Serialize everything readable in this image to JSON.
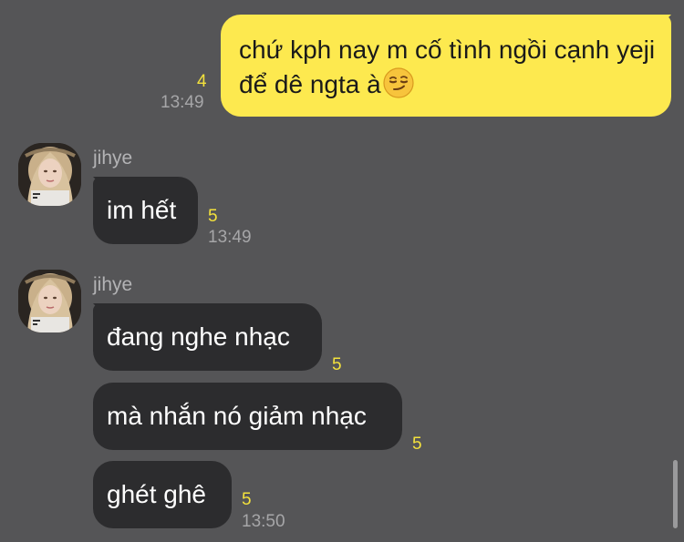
{
  "outgoing": {
    "text": "chứ kph nay m cố tình ngồi cạnh yeji để dê ngta à",
    "emoji": "smirking-face",
    "unread": "4",
    "time": "13:49"
  },
  "groups": [
    {
      "sender": "jihye",
      "messages": [
        {
          "text": "im hết",
          "unread": "5",
          "time": "13:49"
        }
      ]
    },
    {
      "sender": "jihye",
      "messages": [
        {
          "text": "đang nghe nhạc",
          "unread": "5"
        },
        {
          "text": "mà nhắn nó giảm nhạc",
          "unread": "5"
        },
        {
          "text": "ghét ghê",
          "unread": "5",
          "time": "13:50"
        }
      ]
    }
  ],
  "colors": {
    "background": "#555557",
    "incoming_bubble": "#2c2c2e",
    "outgoing_bubble": "#fde94f",
    "unread_count": "#f4e23c",
    "timestamp": "#a6a6a8"
  }
}
